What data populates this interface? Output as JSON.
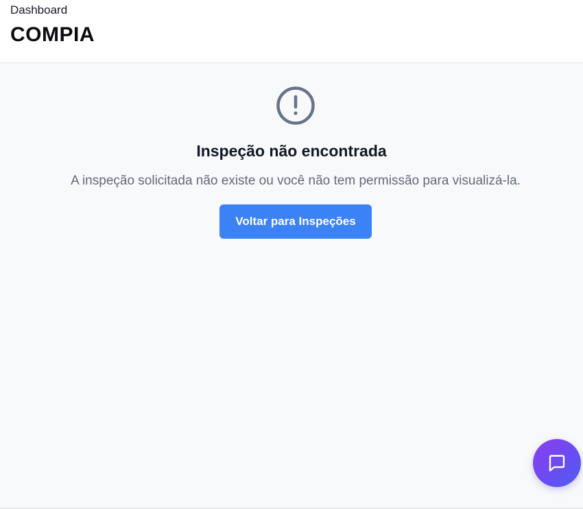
{
  "header": {
    "breadcrumb": "Dashboard",
    "app_title": "COMPIA"
  },
  "error": {
    "icon": "alert-circle-icon",
    "title": "Inspeção não encontrada",
    "message": "A inspeção solicitada não existe ou você não tem permissão para visualizá-la.",
    "back_button_label": "Voltar para Inspeções"
  },
  "chat": {
    "icon": "chat-bubble-icon"
  },
  "colors": {
    "primary": "#3b82f6",
    "icon_gray": "#64748b",
    "fab_gradient_start": "#8b3ff0",
    "fab_gradient_end": "#4f5ef3",
    "background": "#f8f9fb"
  }
}
